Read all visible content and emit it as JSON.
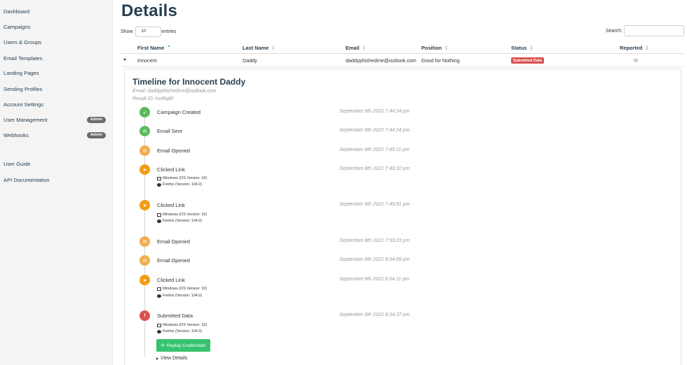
{
  "sidebar": {
    "items": [
      {
        "label": "Dashboard"
      },
      {
        "label": "Campaigns"
      },
      {
        "label": "Users & Groups"
      },
      {
        "label": "Email Templates"
      },
      {
        "label": "Landing Pages"
      },
      {
        "label": "Sending Profiles"
      },
      {
        "label": "Account Settings"
      },
      {
        "label": "User Management",
        "badge": "Admin"
      },
      {
        "label": "Webhooks",
        "badge": "Admin"
      },
      {
        "label": "User Guide"
      },
      {
        "label": "API Documentation"
      }
    ]
  },
  "page": {
    "title": "Details",
    "show_label": "Show",
    "entries_value": "10",
    "entries_label": "entries",
    "search_label": "Search:"
  },
  "table": {
    "headers": [
      "First Name",
      "Last Name",
      "Email",
      "Position",
      "Status",
      "Reported"
    ],
    "row": {
      "first_name": "Innocent",
      "last_name": "Daddy",
      "email": "daddyphishedme@outlook.com",
      "position": "Good for Nothing",
      "status": "Submitted Data"
    }
  },
  "timeline": {
    "title": "Timeline for Innocent Daddy",
    "email": "Email: daddyphishedme@outlook.com",
    "result_id": "Result ID: hs45qBI",
    "events": [
      {
        "label": "Campaign Created",
        "time": "September 8th 2022 7:44:24 pm",
        "color": "#5cb85c",
        "icon": "rocket-icon"
      },
      {
        "label": "Email Sent",
        "time": "September 8th 2022 7:44:24 pm",
        "color": "#5cb85c",
        "icon": "envelope-icon"
      },
      {
        "label": "Email Opened",
        "time": "September 8th 2022 7:49:11 pm",
        "color": "#f0ad4e",
        "icon": "envelope-open-icon"
      },
      {
        "label": "Clicked Link",
        "time": "September 8th 2022 7:49:32 pm",
        "color": "#f39c12",
        "icon": "pointer-icon",
        "os": "Windows (OS Version: 10)",
        "browser": "Firefox (Version: 104.0)"
      },
      {
        "label": "Clicked Link",
        "time": "September 8th 2022 7:49:51 pm",
        "color": "#f39c12",
        "icon": "pointer-icon",
        "os": "Windows (OS Version: 10)",
        "browser": "Firefox (Version: 104.0)"
      },
      {
        "label": "Email Opened",
        "time": "September 8th 2022 7:59:23 pm",
        "color": "#f0ad4e",
        "icon": "envelope-open-icon"
      },
      {
        "label": "Email Opened",
        "time": "September 8th 2022 8:04:09 pm",
        "color": "#f0ad4e",
        "icon": "envelope-open-icon"
      },
      {
        "label": "Clicked Link",
        "time": "September 8th 2022 8:04:11 pm",
        "color": "#f39c12",
        "icon": "pointer-icon",
        "os": "Windows (OS Version: 10)",
        "browser": "Firefox (Version: 104.0)"
      },
      {
        "label": "Submitted Data",
        "time": "September 8th 2022 8:04:37 pm",
        "color": "#d9534f",
        "icon": "exclamation-icon",
        "os": "Windows (OS Version: 10)",
        "browser": "Firefox (Version: 104.0)"
      }
    ],
    "replay_label": "Replay Credentials",
    "view_details_label": "View Details"
  }
}
